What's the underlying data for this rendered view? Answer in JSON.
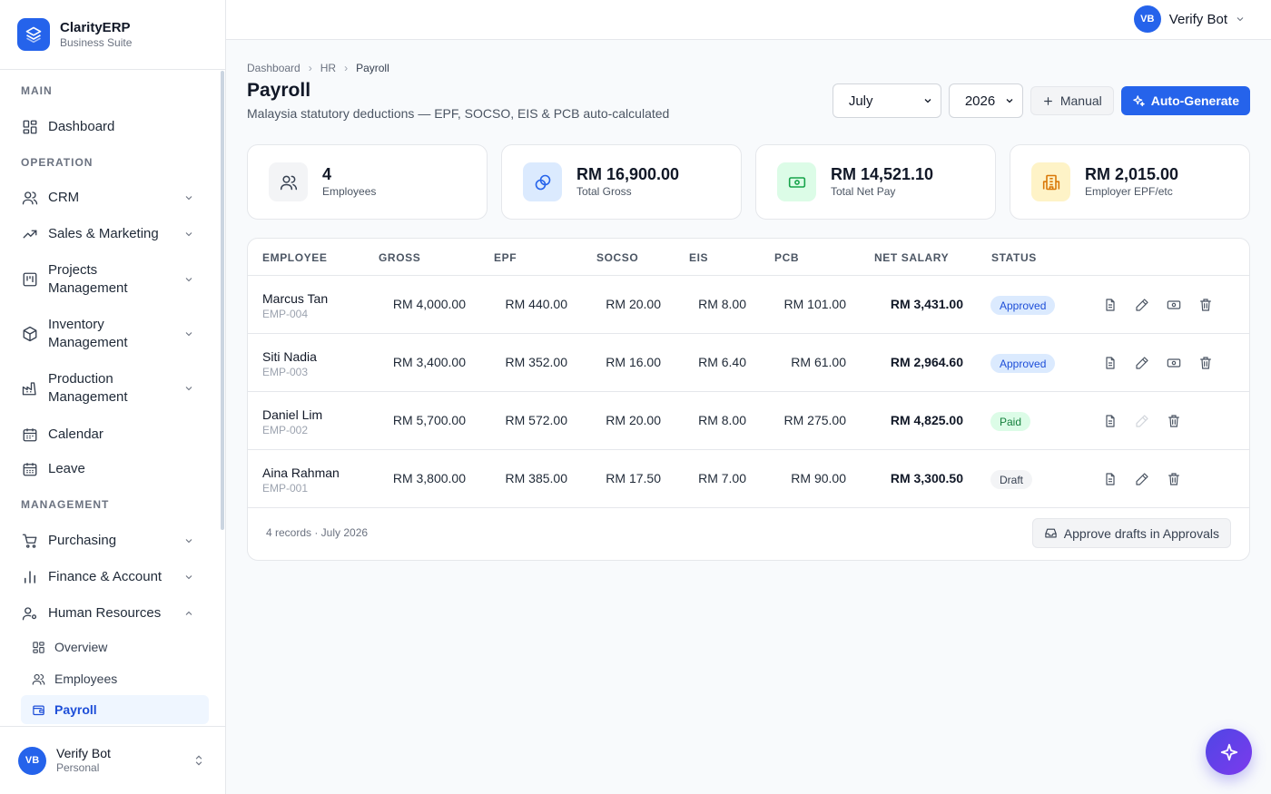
{
  "brand": {
    "name": "ClarityERP",
    "subtitle": "Business Suite"
  },
  "sidebar": {
    "sections": {
      "main": "MAIN",
      "operation": "OPERATION",
      "management": "MANAGEMENT"
    },
    "items": {
      "dashboard": "Dashboard",
      "crm": "CRM",
      "sales": "Sales & Marketing",
      "projects": [
        "Projects",
        "Management"
      ],
      "inventory": [
        "Inventory",
        "Management"
      ],
      "production": [
        "Production",
        "Management"
      ],
      "calendar": "Calendar",
      "leave": "Leave",
      "purchasing": "Purchasing",
      "finance": "Finance & Account",
      "hr": "Human Resources"
    },
    "hr_sub": {
      "overview": "Overview",
      "employees": "Employees",
      "payroll": "Payroll"
    },
    "user": {
      "initials": "VB",
      "name": "Verify Bot",
      "plan": "Personal"
    }
  },
  "topbar": {
    "initials": "VB",
    "name": "Verify Bot"
  },
  "breadcrumb": [
    "Dashboard",
    "HR",
    "Payroll"
  ],
  "page": {
    "title": "Payroll",
    "subtitle": "Malaysia statutory deductions — EPF, SOCSO, EIS & PCB auto-calculated"
  },
  "controls": {
    "month": "July",
    "year": "2026",
    "manual_label": "Manual",
    "auto_label": "Auto-Generate"
  },
  "cards": [
    {
      "value": "4",
      "label": "Employees",
      "icon": "users-icon"
    },
    {
      "value": "RM 16,900.00",
      "label": "Total Gross",
      "icon": "coins-icon"
    },
    {
      "value": "RM 14,521.10",
      "label": "Total Net Pay",
      "icon": "banknote-icon"
    },
    {
      "value": "RM 2,015.00",
      "label": "Employer EPF/etc",
      "icon": "building-icon"
    }
  ],
  "table": {
    "headers": [
      "EMPLOYEE",
      "GROSS",
      "EPF",
      "SOCSO",
      "EIS",
      "PCB",
      "NET SALARY",
      "STATUS"
    ],
    "rows": [
      {
        "name": "Marcus Tan",
        "id": "EMP-004",
        "gross": "RM 4,000.00",
        "epf": "RM 440.00",
        "socso": "RM 20.00",
        "eis": "RM 8.00",
        "pcb": "RM 101.00",
        "net": "RM 3,431.00",
        "status": "Approved"
      },
      {
        "name": "Siti Nadia",
        "id": "EMP-003",
        "gross": "RM 3,400.00",
        "epf": "RM 352.00",
        "socso": "RM 16.00",
        "eis": "RM 6.40",
        "pcb": "RM 61.00",
        "net": "RM 2,964.60",
        "status": "Approved"
      },
      {
        "name": "Daniel Lim",
        "id": "EMP-002",
        "gross": "RM 5,700.00",
        "epf": "RM 572.00",
        "socso": "RM 20.00",
        "eis": "RM 8.00",
        "pcb": "RM 275.00",
        "net": "RM 4,825.00",
        "status": "Paid"
      },
      {
        "name": "Aina Rahman",
        "id": "EMP-001",
        "gross": "RM 3,800.00",
        "epf": "RM 385.00",
        "socso": "RM 17.50",
        "eis": "RM 7.00",
        "pcb": "RM 90.00",
        "net": "RM 3,300.50",
        "status": "Draft"
      }
    ],
    "footer_info": "4 records · July 2026",
    "approve_label": "Approve drafts in Approvals"
  },
  "colors": {
    "accent": "#2563eb",
    "approved": "#dbeafe",
    "paid": "#dcfce7",
    "draft": "#f3f4f6"
  }
}
